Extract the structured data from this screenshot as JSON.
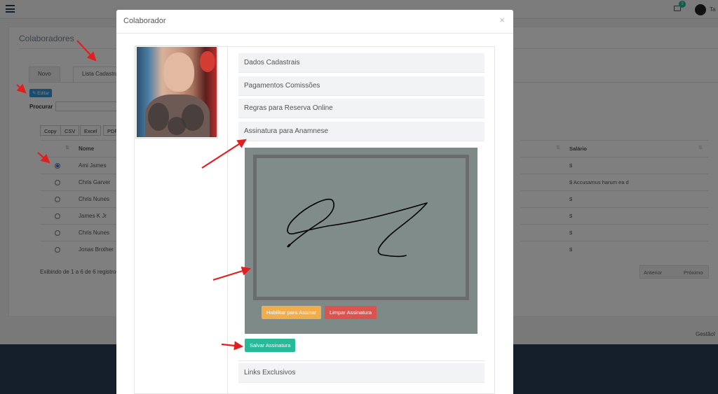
{
  "topbar": {
    "notifications": "3",
    "user_name": "Ta"
  },
  "page": {
    "title": "Colaboradores",
    "tabs": [
      {
        "label": "Novo"
      },
      {
        "label": "Lista Cadastra"
      }
    ],
    "edit_label": "✎ Editar",
    "search_label": "Procurar",
    "export_buttons": [
      "Copy",
      "CSV",
      "Excel",
      "PDF"
    ],
    "table": {
      "name_header": "Nome",
      "salary_header": "Salário",
      "rows": [
        {
          "name": "Ami James",
          "salary": "$",
          "selected": true
        },
        {
          "name": "Chris Garver",
          "salary": "$ Accusamus harum ea d",
          "selected": false
        },
        {
          "name": "Chris Nunes",
          "salary": "$",
          "selected": false
        },
        {
          "name": "James K Jr",
          "salary": "$",
          "selected": false
        },
        {
          "name": "Chris Nunes",
          "salary": "$",
          "selected": false
        },
        {
          "name": "Jonas Brother",
          "salary": "$",
          "selected": false
        }
      ],
      "info": "Exibindo de 1 a 6 de 6 registro"
    },
    "pager": {
      "previous": "Anterior",
      "next": "Próximo"
    },
    "footer": "GestãoI"
  },
  "modal": {
    "title": "Colaborador",
    "close": "×",
    "sections": [
      "Dados Cadastrais",
      "Pagamentos Comissões",
      "Regras para Reserva Online",
      "Assinatura para Anamnese",
      "Links Exclusivos"
    ],
    "enable_sign_label": "Habilitar para Assinar",
    "clear_sign_label": "Limpar Assinatura",
    "save_sign_label": "Salvar Assinatura"
  },
  "colors": {
    "accent_teal": "#26b99a",
    "warning": "#f0ad4e",
    "danger": "#d9534f",
    "primary": "#3498db",
    "annotation_red": "#e02020"
  }
}
